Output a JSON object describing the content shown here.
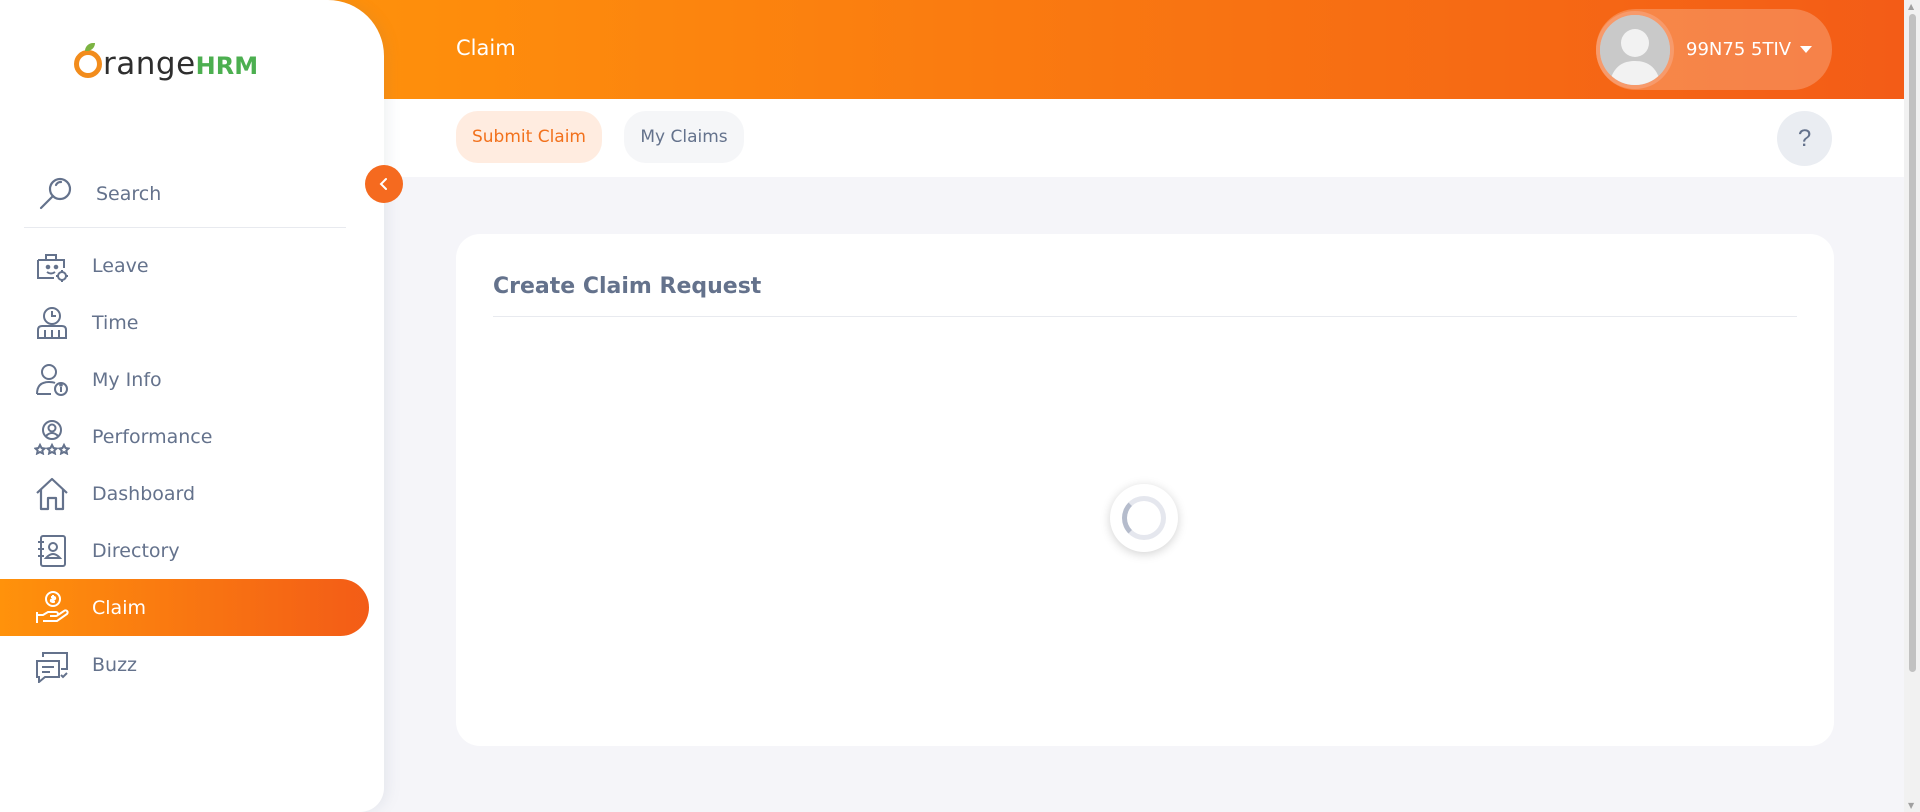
{
  "app": {
    "brand_orange": "range",
    "brand_hrm": "HRM",
    "accent_color": "#f35c17",
    "accent_color_light": "#ff920b"
  },
  "header": {
    "page_title": "Claim",
    "user_name": "99N75 5TIV"
  },
  "sidebar": {
    "search_placeholder": "Search",
    "items": [
      {
        "label": "Leave",
        "icon": "leave-icon",
        "active": false
      },
      {
        "label": "Time",
        "icon": "time-icon",
        "active": false
      },
      {
        "label": "My Info",
        "icon": "my-info-icon",
        "active": false
      },
      {
        "label": "Performance",
        "icon": "performance-icon",
        "active": false
      },
      {
        "label": "Dashboard",
        "icon": "dashboard-icon",
        "active": false
      },
      {
        "label": "Directory",
        "icon": "directory-icon",
        "active": false
      },
      {
        "label": "Claim",
        "icon": "claim-icon",
        "active": true
      },
      {
        "label": "Buzz",
        "icon": "buzz-icon",
        "active": false
      }
    ]
  },
  "subnav": {
    "tabs": [
      {
        "label": "Submit Claim",
        "active": true
      },
      {
        "label": "My Claims",
        "active": false
      }
    ],
    "help_label": "?"
  },
  "main": {
    "card_title": "Create Claim Request"
  }
}
